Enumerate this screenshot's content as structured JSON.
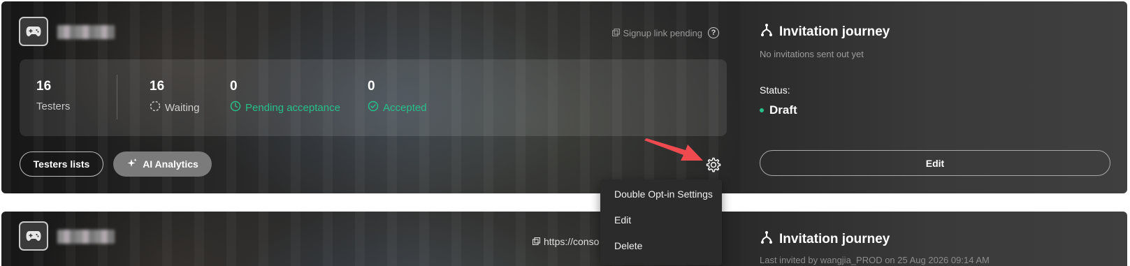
{
  "cards": [
    {
      "signup_link_text": "Signup link pending",
      "stats": [
        {
          "value": "16",
          "label": "Testers",
          "color": "#c8c8c8"
        },
        {
          "value": "16",
          "label": "Waiting",
          "color": "#d0d0d0",
          "icon": "dashed-circle-icon"
        },
        {
          "value": "0",
          "label": "Pending acceptance",
          "color": "#27c08a",
          "icon": "clock-icon"
        },
        {
          "value": "0",
          "label": "Accepted",
          "color": "#27c08a",
          "icon": "check-circle-icon"
        }
      ],
      "buttons": {
        "testers_lists": "Testers lists",
        "ai_analytics": "AI Analytics"
      },
      "journey": {
        "title": "Invitation journey",
        "subtitle": "No invitations sent out yet",
        "status_label": "Status:",
        "status_value": "Draft",
        "edit_label": "Edit"
      }
    },
    {
      "url_text": "https://conso",
      "journey": {
        "title": "Invitation journey",
        "subtitle": "Last invited by wangjia_PROD on 25 Aug 2026 09:14 AM"
      }
    }
  ],
  "context_menu": {
    "items": [
      "Double Opt-in Settings",
      "Edit",
      "Delete"
    ]
  },
  "colors": {
    "accent_green": "#27c08a",
    "annotation_arrow": "#ee4a4f"
  }
}
